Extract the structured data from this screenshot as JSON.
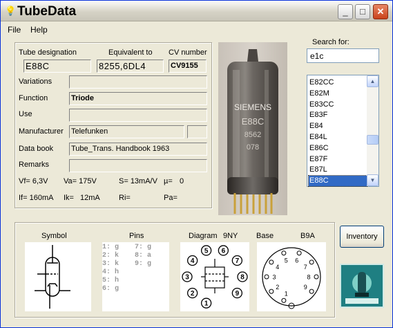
{
  "window": {
    "title": "TubeData",
    "buttons": {
      "minimize": "_",
      "maximize": "□",
      "close": "✕"
    }
  },
  "menu": {
    "file": "File",
    "help": "Help"
  },
  "form": {
    "labels": {
      "designation": "Tube designation",
      "equivalent": "Equivalent to",
      "cv": "CV number",
      "variations": "Variations",
      "function": "Function",
      "use": "Use",
      "manufacturer": "Manufacturer",
      "databook": "Data book",
      "remarks": "Remarks"
    },
    "values": {
      "designation": "E88C",
      "equivalent": "8255,6DL4",
      "cv": "CV9155",
      "variations": "",
      "function": "Triode",
      "use": "",
      "manufacturer": "Telefunken",
      "manufacturer_extra": "",
      "databook": "Tube_Trans. Handbook 1963",
      "remarks": ""
    },
    "specs": {
      "vf": "Vf= 6,3V",
      "va": "Va= 175V",
      "s": "S= 13mA/V",
      "mu": "µ=",
      "mu_val": "0",
      "if": "If= 160mA",
      "ik": "Ik=",
      "ik_val": "12mA",
      "ri": "Ri=",
      "pa": "Pa="
    }
  },
  "photo": {
    "brand": "SIEMENS",
    "type": "E88C",
    "code1": "8562",
    "code2": "078"
  },
  "search": {
    "label": "Search for:",
    "value": "e1c"
  },
  "list": {
    "items": [
      "E82CC",
      "E82M",
      "E83CC",
      "E83F",
      "E84",
      "E84L",
      "E86C",
      "E87F",
      "E87L",
      "E88C"
    ],
    "selected": "E88C"
  },
  "bottom": {
    "symbol_title": "Symbol",
    "pins_title": "Pins",
    "diagram_title": "Diagram",
    "diagram_code": "9NY",
    "base_title": "Base",
    "base_code": "B9A",
    "pins_left": [
      "1: g",
      "2: k",
      "3: k",
      "4: h",
      "5: h",
      "6: g"
    ],
    "pins_right": [
      "7: g",
      "8: a",
      "9: g"
    ],
    "diagram_pins": [
      "1",
      "2",
      "3",
      "4",
      "5",
      "6",
      "7",
      "8",
      "9"
    ],
    "base_pins": [
      "1",
      "2",
      "3",
      "4",
      "5",
      "6",
      "7",
      "8",
      "9"
    ]
  },
  "inventory_label": "Inventory",
  "icons": {
    "app": "lightbulb-icon",
    "scroll_up": "chevron-up-icon",
    "scroll_down": "chevron-down-icon"
  }
}
